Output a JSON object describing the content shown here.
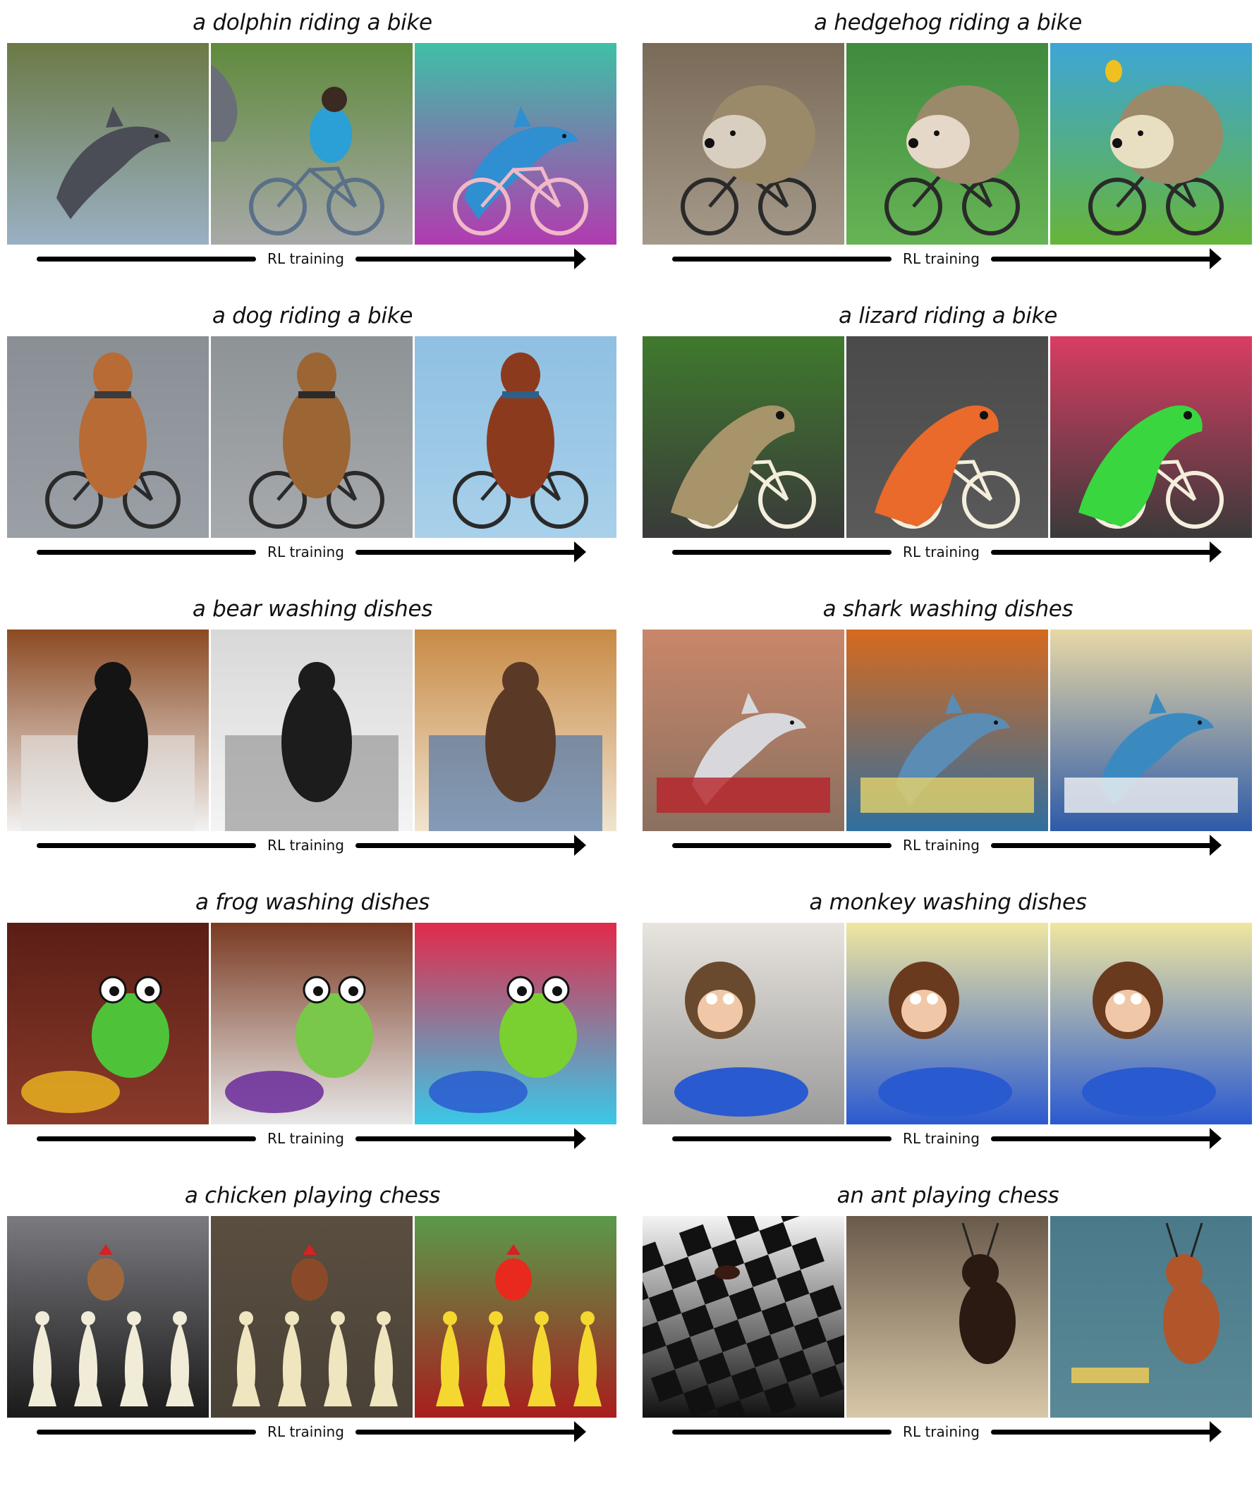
{
  "figure": {
    "axis_label": "RL training",
    "groups": [
      {
        "prompt": "a dolphin riding a bike",
        "images": [
          "dolphin-photo-jumping-over-lake",
          "boy-on-bike-with-dolphin",
          "cartoon-dolphin-riding-bike"
        ]
      },
      {
        "prompt": "a hedgehog riding a bike",
        "images": [
          "hedgehog-photo-on-bike-wheel",
          "watercolor-hedgehog-on-bike",
          "painted-hedgehog-riding-bike-with-balloon"
        ]
      },
      {
        "prompt": "a dog riding a bike",
        "images": [
          "dog-photo-riding-bike-on-road",
          "dog-photo-pedaling-bike",
          "painted-dog-riding-bike"
        ]
      },
      {
        "prompt": "a lizard riding a bike",
        "images": [
          "lizard-photo-on-tire",
          "orange-lizard-on-bike",
          "cartoon-green-lizard-riding-bike"
        ]
      },
      {
        "prompt": "a bear washing dishes",
        "images": [
          "bear-figure-on-sink",
          "sketched-bear-in-kitchen",
          "painted-bear-washing-dishes"
        ]
      },
      {
        "prompt": "a shark washing dishes",
        "images": [
          "shark-photo-in-sink",
          "cartoon-shark-at-sink",
          "cartoon-shark-washing-dishes"
        ]
      },
      {
        "prompt": "a frog washing dishes",
        "images": [
          "frog-at-kitchen-sink",
          "cartoon-frog-with-basin",
          "cartoon-frog-washing-dishes"
        ]
      },
      {
        "prompt": "a monkey washing dishes",
        "images": [
          "monkey-photo-at-sink",
          "cartoon-monkey-with-basin",
          "cartoon-monkey-washing-dishes"
        ]
      },
      {
        "prompt": "a chicken playing chess",
        "images": [
          "chicken-photo-on-chessboard",
          "painted-chicken-with-chess-pieces",
          "cartoon-chickens-playing-chess"
        ]
      },
      {
        "prompt": "an ant playing chess",
        "images": [
          "ant-photo-on-checkerboard",
          "sepia-ant-on-board",
          "painted-ants-playing-chess"
        ]
      }
    ]
  }
}
